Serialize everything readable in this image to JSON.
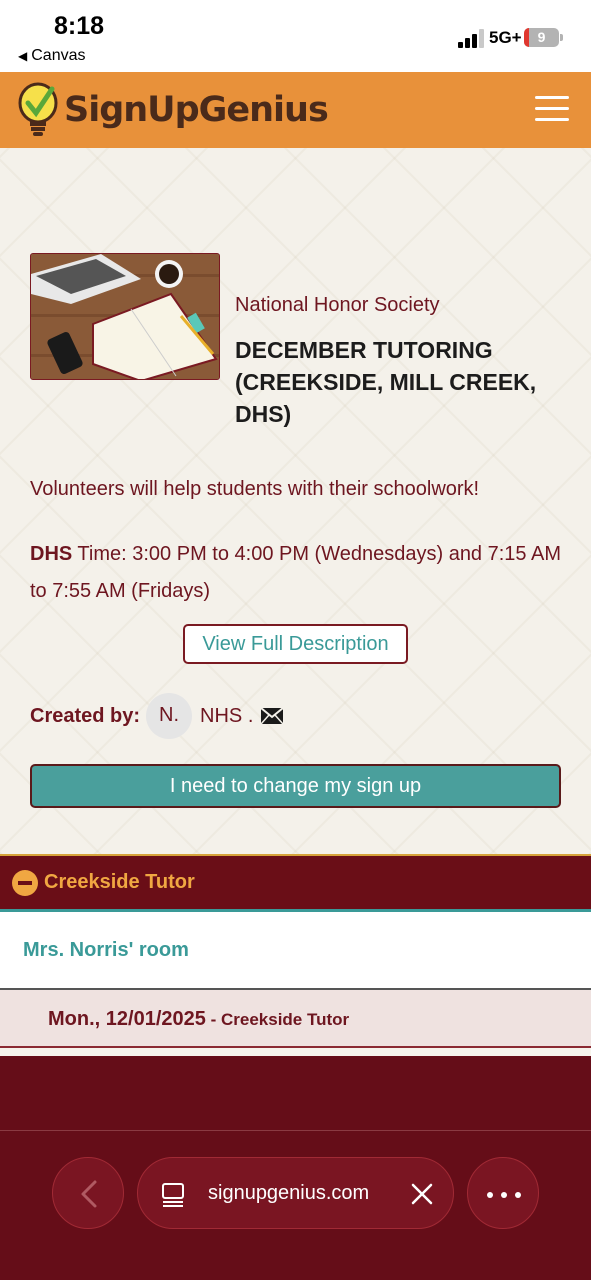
{
  "status_bar": {
    "time": "8:18",
    "back_app": "Canvas",
    "network": "5G+",
    "battery": "9"
  },
  "header": {
    "logo_text": "SignUpGenius",
    "menu_icon": "hamburger-icon"
  },
  "event": {
    "organization": "National Honor Society",
    "title": "DECEMBER TUTORING (CREEKSIDE, MILL CREEK, DHS)",
    "description": "Volunteers will help students with their schoolwork!",
    "time_label": "DHS",
    "time_text": " Time: 3:00 PM to 4:00 PM (Wednesdays) and 7:15 AM to 7:55 AM (Fridays)",
    "view_full_label": "View Full Description",
    "created_by_label": "Created by:",
    "creator_initial": "N.",
    "creator_name": "NHS .",
    "change_signup_label": "I need to change my sign up"
  },
  "section": {
    "title": "Creekside Tutor",
    "location": "Mrs. Norris' room",
    "date": "Mon., 12/01/2025",
    "date_suffix": " - Creekside Tutor"
  },
  "browser": {
    "url": "signupgenius.com"
  },
  "colors": {
    "header_bg": "#e8913a",
    "maroon": "#6a0e17",
    "teal": "#4a9f9c",
    "gold": "#f0a742"
  }
}
